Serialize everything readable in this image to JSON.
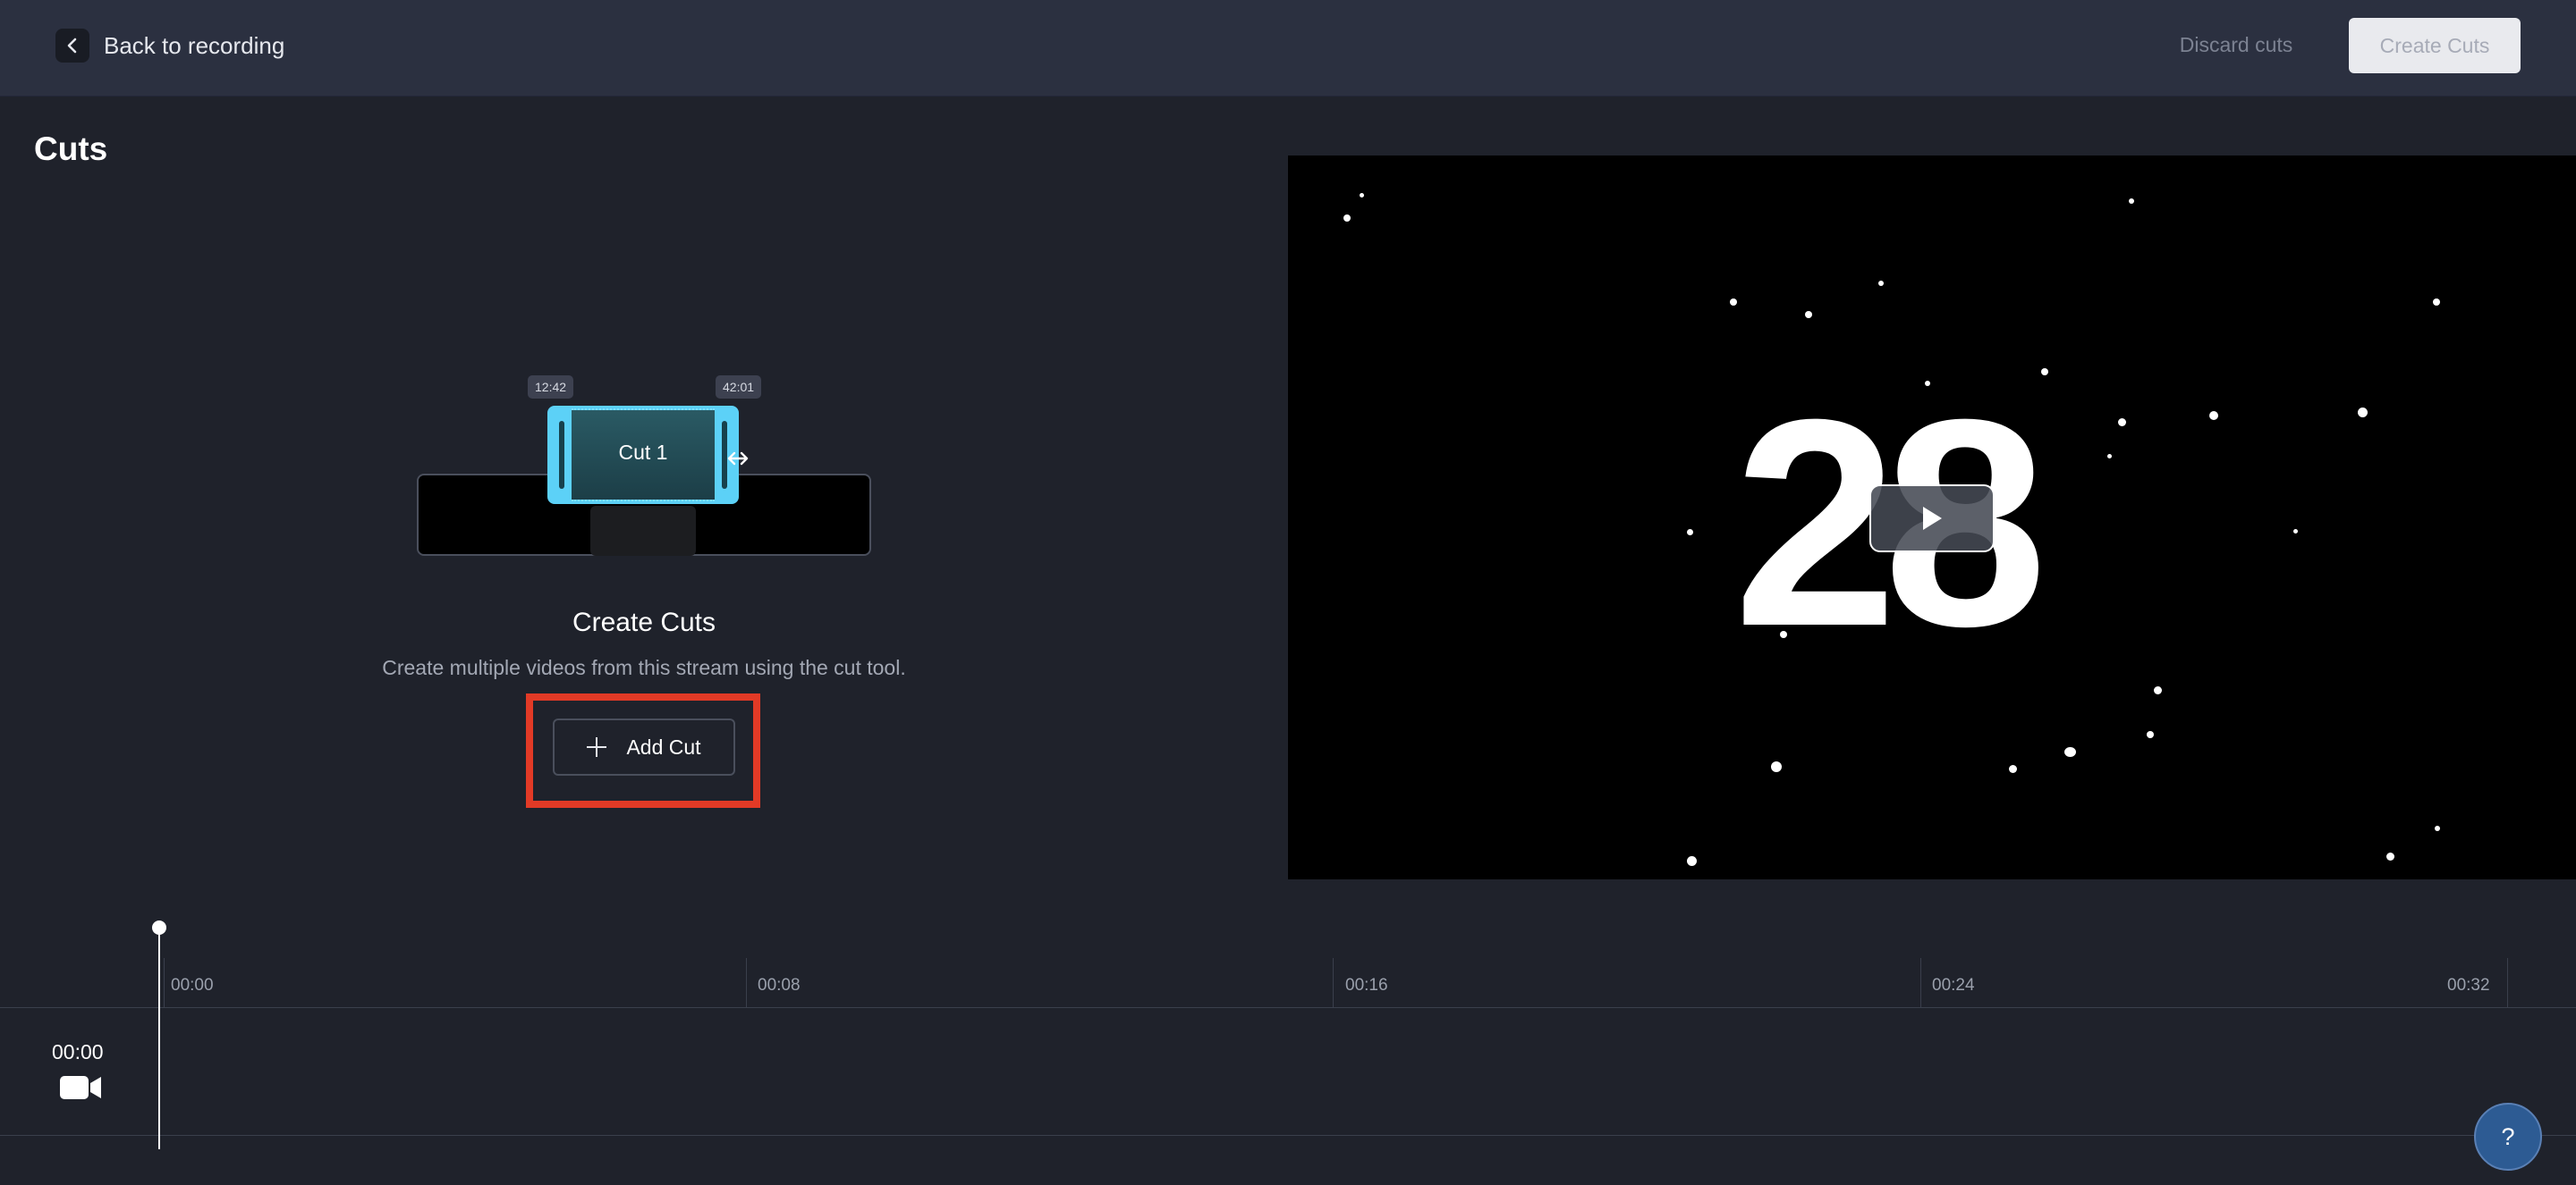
{
  "header": {
    "back_label": "Back to recording",
    "discard_label": "Discard cuts",
    "create_label": "Create Cuts"
  },
  "page": {
    "title": "Cuts"
  },
  "illustration": {
    "cut_label": "Cut 1",
    "start_time": "12:42",
    "end_time": "42:01"
  },
  "empty_state": {
    "title": "Create Cuts",
    "description": "Create multiple videos from this stream using the cut tool.",
    "add_cut_label": "Add Cut"
  },
  "preview": {
    "countdown": "28"
  },
  "timeline": {
    "ticks": [
      "00:00",
      "00:08",
      "00:16",
      "00:24",
      "00:32"
    ],
    "current_time": "00:00"
  },
  "help": {
    "label": "?"
  },
  "colors": {
    "background": "#1f222b",
    "header": "#2b3040",
    "accent_cut": "#5cd1f7",
    "highlight": "#e23a26",
    "help": "#2d5b93"
  }
}
